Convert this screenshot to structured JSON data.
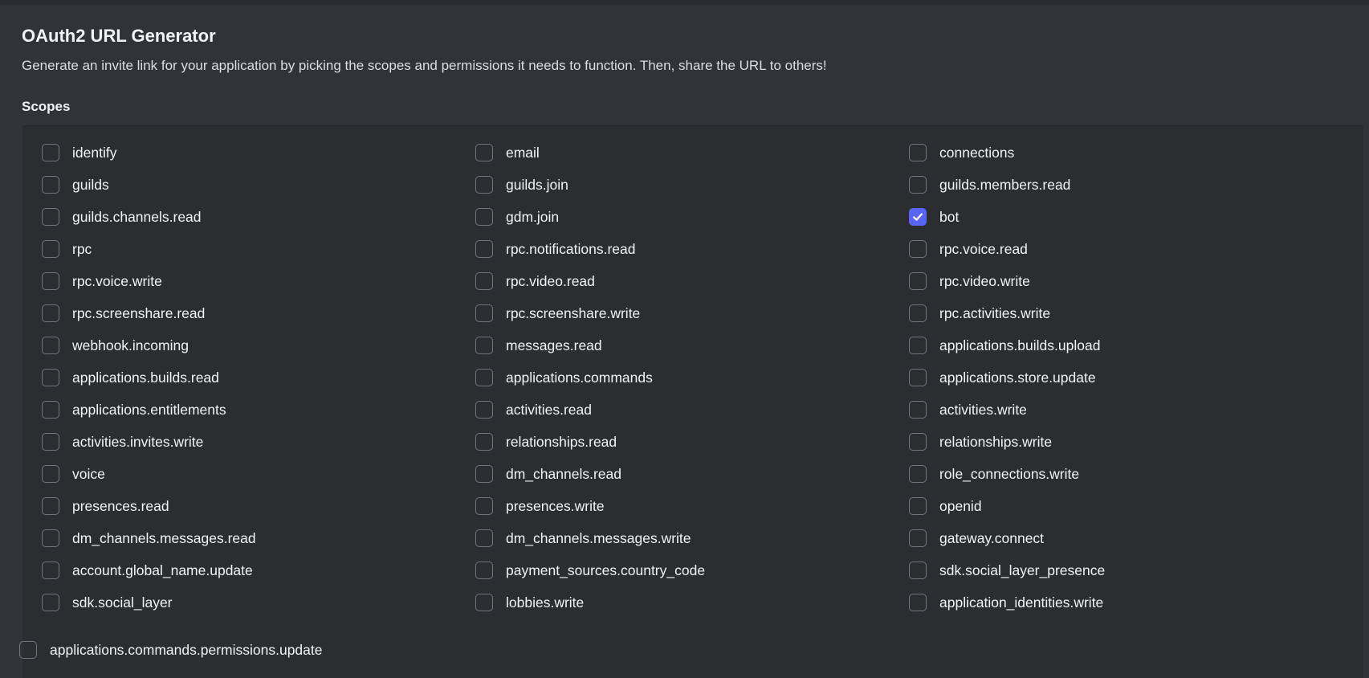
{
  "header": {
    "title": "OAuth2 URL Generator",
    "subtitle": "Generate an invite link for your application by picking the scopes and permissions it needs to function. Then, share the URL to others!",
    "section_label": "Scopes"
  },
  "colors": {
    "accent": "#5865f2",
    "background": "#323339",
    "panel": "#2b2d31"
  },
  "scopes": [
    {
      "label": "identify",
      "checked": false
    },
    {
      "label": "email",
      "checked": false
    },
    {
      "label": "connections",
      "checked": false
    },
    {
      "label": "guilds",
      "checked": false
    },
    {
      "label": "guilds.join",
      "checked": false
    },
    {
      "label": "guilds.members.read",
      "checked": false
    },
    {
      "label": "guilds.channels.read",
      "checked": false
    },
    {
      "label": "gdm.join",
      "checked": false
    },
    {
      "label": "bot",
      "checked": true
    },
    {
      "label": "rpc",
      "checked": false
    },
    {
      "label": "rpc.notifications.read",
      "checked": false
    },
    {
      "label": "rpc.voice.read",
      "checked": false
    },
    {
      "label": "rpc.voice.write",
      "checked": false
    },
    {
      "label": "rpc.video.read",
      "checked": false
    },
    {
      "label": "rpc.video.write",
      "checked": false
    },
    {
      "label": "rpc.screenshare.read",
      "checked": false
    },
    {
      "label": "rpc.screenshare.write",
      "checked": false
    },
    {
      "label": "rpc.activities.write",
      "checked": false
    },
    {
      "label": "webhook.incoming",
      "checked": false
    },
    {
      "label": "messages.read",
      "checked": false
    },
    {
      "label": "applications.builds.upload",
      "checked": false
    },
    {
      "label": "applications.builds.read",
      "checked": false
    },
    {
      "label": "applications.commands",
      "checked": false
    },
    {
      "label": "applications.store.update",
      "checked": false
    },
    {
      "label": "applications.entitlements",
      "checked": false
    },
    {
      "label": "activities.read",
      "checked": false
    },
    {
      "label": "activities.write",
      "checked": false
    },
    {
      "label": "activities.invites.write",
      "checked": false
    },
    {
      "label": "relationships.read",
      "checked": false
    },
    {
      "label": "relationships.write",
      "checked": false
    },
    {
      "label": "voice",
      "checked": false
    },
    {
      "label": "dm_channels.read",
      "checked": false
    },
    {
      "label": "role_connections.write",
      "checked": false
    },
    {
      "label": "presences.read",
      "checked": false
    },
    {
      "label": "presences.write",
      "checked": false
    },
    {
      "label": "openid",
      "checked": false
    },
    {
      "label": "dm_channels.messages.read",
      "checked": false
    },
    {
      "label": "dm_channels.messages.write",
      "checked": false
    },
    {
      "label": "gateway.connect",
      "checked": false
    },
    {
      "label": "account.global_name.update",
      "checked": false
    },
    {
      "label": "payment_sources.country_code",
      "checked": false
    },
    {
      "label": "sdk.social_layer_presence",
      "checked": false
    },
    {
      "label": "sdk.social_layer",
      "checked": false
    },
    {
      "label": "lobbies.write",
      "checked": false
    },
    {
      "label": "application_identities.write",
      "checked": false
    }
  ],
  "extra_scopes": [
    {
      "label": "applications.commands.permissions.update",
      "checked": false
    }
  ]
}
